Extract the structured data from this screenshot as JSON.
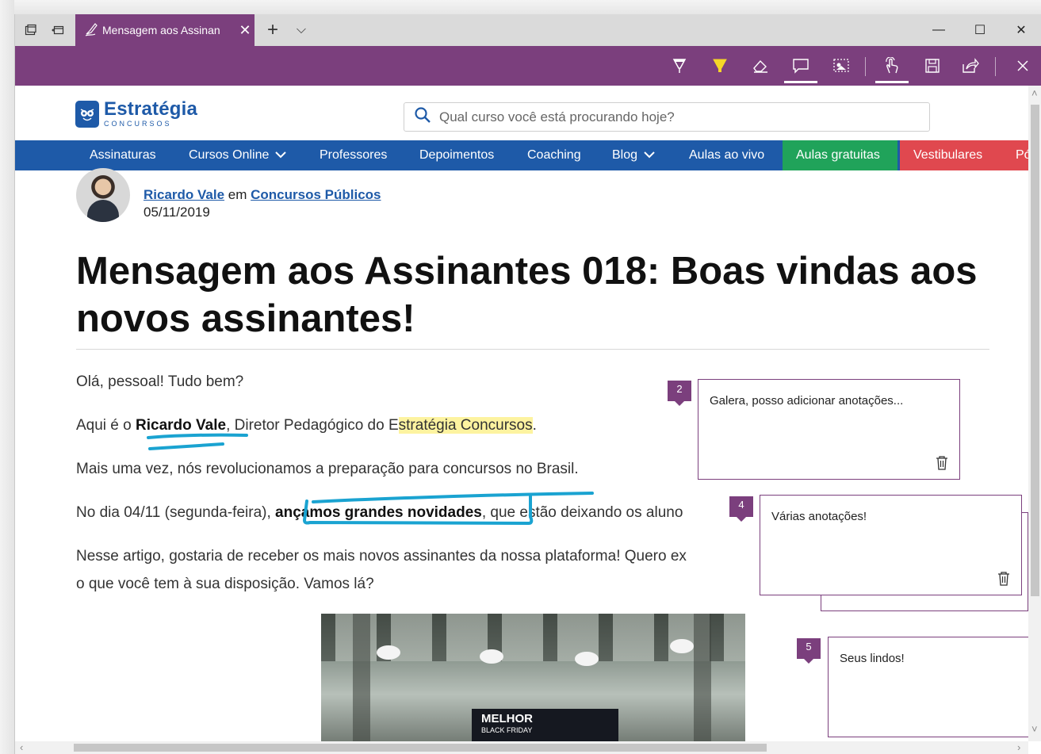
{
  "browser": {
    "tab_title": "Mensagem aos Assinan",
    "tab_close": "✕",
    "new_tab": "+",
    "tab_menu": "⌵",
    "minimize": "—",
    "maximize": "☐",
    "close": "✕"
  },
  "ink_toolbar": {
    "tools": [
      "ballpoint-pen-icon",
      "highlighter-icon",
      "eraser-icon",
      "add-note-icon",
      "clip-icon",
      "touch-writing-icon",
      "save-icon",
      "share-icon",
      "exit-icon"
    ],
    "active_tools": [
      "add-note-icon",
      "touch-writing-icon"
    ],
    "colors": {
      "purple": "#7b3f7d",
      "highlighter": "#f5d627"
    }
  },
  "site": {
    "logo_name": "Estratégia",
    "logo_sub": "CONCURSOS",
    "search_placeholder": "Qual curso você está procurando hoje?",
    "nav": [
      {
        "label": "Assinaturas"
      },
      {
        "label": "Cursos Online",
        "has_chevron": true
      },
      {
        "label": "Professores"
      },
      {
        "label": "Depoimentos"
      },
      {
        "label": "Coaching"
      },
      {
        "label": "Blog",
        "has_chevron": true
      },
      {
        "label": "Aulas ao vivo"
      },
      {
        "label": "Aulas gratuitas",
        "color": "#20a35a"
      },
      {
        "label": "Vestibulares",
        "color": "#e0484f"
      },
      {
        "label": "Pó"
      }
    ],
    "brand_color": "#1e5aa8"
  },
  "article": {
    "author": "Ricardo Vale",
    "author_connector": " em ",
    "category": "Concursos Públicos",
    "date": "05/11/2019",
    "title": "Mensagem aos Assinantes 018: Boas vindas aos novos assinantes!",
    "p1": "Olá, pessoal! Tudo bem?",
    "p2_prefix": "Aqui é o ",
    "p2_bold": "Ricardo Vale",
    "p2_mid": ", Diretor Pedagógico do E",
    "p2_highlight": "stratégia Concursos",
    "p2_suffix": ".",
    "p3": "Mais uma vez, nós revolucionamos a preparação para concursos no Brasil.",
    "p4_prefix": "No dia 04/11 (segunda-feira), ",
    "p4_bold": "ançamos grandes novidades",
    "p4_suffix": ", que estão deixando os aluno",
    "p5_line1": "Nesse artigo, gostaria de receber os mais novos assinantes da nossa plataforma! Quero ex",
    "p5_line2": "o que você tem à sua disposição. Vamos lá?",
    "image_banner": "MELHOR",
    "image_banner_sub": "BLACK FRIDAY"
  },
  "notes": [
    {
      "number": "2",
      "text": "Galera, posso adicionar anotações..."
    },
    {
      "number": "4",
      "text": "Várias anotações!"
    },
    {
      "number": "5",
      "text": "Seus lindos!"
    }
  ]
}
